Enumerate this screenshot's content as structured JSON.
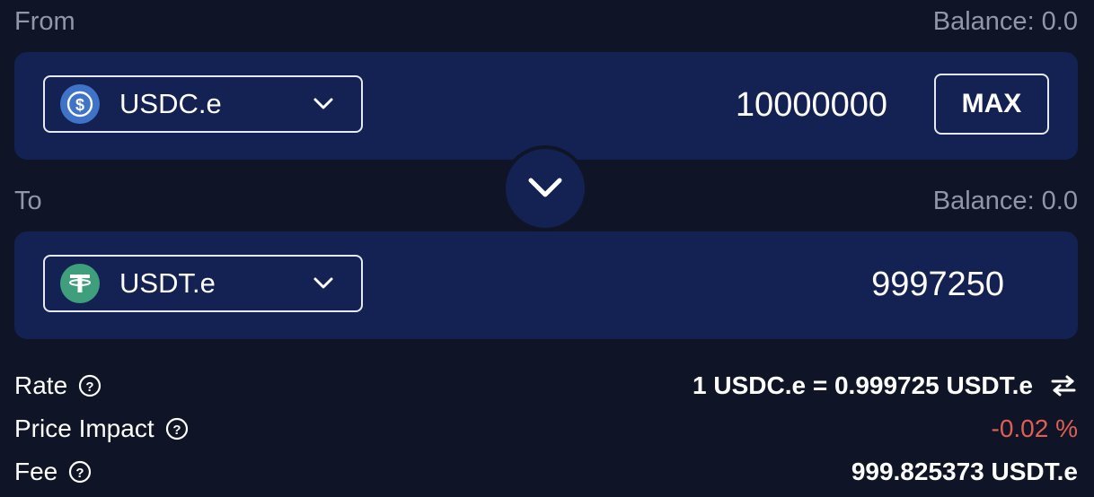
{
  "from": {
    "label": "From",
    "balance": "Balance: 0.0",
    "token": "USDC.e",
    "amount": "10000000",
    "max_label": "MAX"
  },
  "to": {
    "label": "To",
    "balance": "Balance: 0.0",
    "token": "USDT.e",
    "amount": "9997250"
  },
  "details": {
    "rate_label": "Rate",
    "rate_value": "1 USDC.e = 0.999725 USDT.e",
    "impact_label": "Price Impact",
    "impact_value": "-0.02 %",
    "fee_label": "Fee",
    "fee_value": "999.825373 USDT.e"
  },
  "colors": {
    "background": "#0f1427",
    "panel": "#132252",
    "negative": "#e05f55",
    "usdc": "#3f73c8",
    "usdt": "#3f9e7b"
  },
  "icons": [
    "usdc-icon",
    "usdt-icon",
    "chevron-down-icon",
    "arrow-down-icon",
    "help-icon",
    "swap-rate-icon"
  ]
}
